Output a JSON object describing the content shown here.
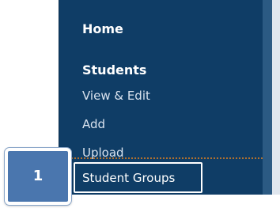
{
  "menu": {
    "home": "Home",
    "students": "Students",
    "view_edit": "View & Edit",
    "add": "Add",
    "upload": "Upload",
    "student_groups": "Student Groups"
  },
  "step_badge": {
    "number": "1"
  },
  "colors": {
    "panel": "#0f3d66",
    "badge": "#4a76ae",
    "divider": "#b0702f"
  }
}
